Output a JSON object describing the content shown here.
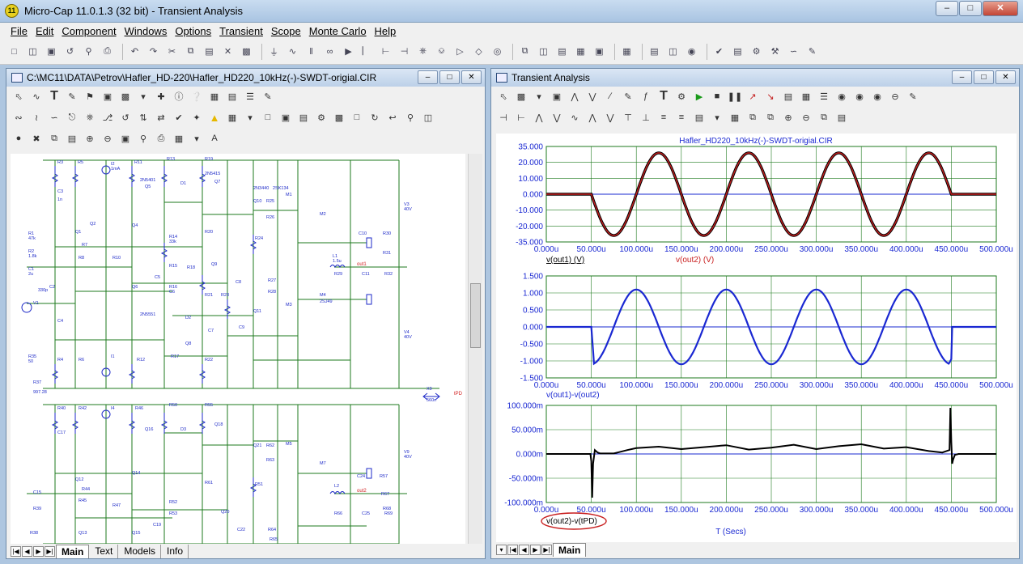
{
  "window": {
    "title": "Micro-Cap 11.0.1.3 (32 bit) - Transient Analysis",
    "icon_text": "11"
  },
  "menu": [
    "File",
    "Edit",
    "Component",
    "Windows",
    "Options",
    "Transient",
    "Scope",
    "Monte Carlo",
    "Help"
  ],
  "schematic_window": {
    "title": "C:\\MC11\\DATA\\Petrov\\Hafler_HD-220\\Hafler_HD220_10kHz(-)-SWDT-origial.CIR",
    "tabs": [
      "Main",
      "Text",
      "Models",
      "Info"
    ],
    "active_tab": "Main",
    "labels": {
      "r3": "R3",
      "r5": "R5",
      "i2": "I2",
      "i2v": "1mA",
      "r11": "R11",
      "r13": "R13",
      "r19": "R19",
      "n2n5415": "2N5415",
      "q7": "Q7",
      "q5": "Q5",
      "n2n5401": "2N5401",
      "d1": "D1",
      "c3": "C3",
      "c3v": "1n",
      "q2": "Q2",
      "r1": "R1",
      "r1v": "47k",
      "r2": "R2",
      "r2v": "1.8k",
      "c1": "C1",
      "c1v": "2u",
      "v1": "V1",
      "c2": "C2",
      "c2v": "330p",
      "q1": "Q1",
      "r7": "R7",
      "r8": "R8",
      "r10": "R10",
      "q6": "Q6",
      "q4": "Q4",
      "r14": "R14",
      "r14v": "33k",
      "r15": "R15",
      "r18": "R18",
      "c5": "C5",
      "c6": "C6",
      "r16": "R16",
      "q9": "Q9",
      "r20": "R20",
      "r21": "R21",
      "r23": "R23",
      "c8": "C8",
      "q10": "Q10",
      "n2n3440": "2N3440",
      "n2sk134": "2SK134",
      "m1": "M1",
      "r25": "R25",
      "r26": "R26",
      "m2": "M2",
      "r24": "R24",
      "v3": "V3",
      "v3v": "40V",
      "c10": "C10",
      "r30": "R30",
      "l1": "L1",
      "l1v": "1.5u",
      "out1": "out1",
      "r31": "R31",
      "r29": "R29",
      "c11": "C11",
      "r32": "R32",
      "r27": "R27",
      "r28": "R28",
      "m3": "M3",
      "m4": "M4",
      "n2sj49": "2SJ49",
      "q11": "Q11",
      "c9": "C9",
      "c7": "C7",
      "d2": "D2",
      "q8": "Q8",
      "n2n5551": "2N5551",
      "c4": "C4",
      "r4": "R4",
      "r6": "R6",
      "i1": "I1",
      "r12": "R12",
      "r17": "R17",
      "r22": "R22",
      "v4": "V4",
      "v4v": "40V",
      "r35": "R35",
      "r35v": "50",
      "r37": "R37",
      "r37v": "997.28",
      "x9": "X9",
      "x9v": "560n",
      "tpd": "tPD",
      "r40": "R40",
      "r42": "R42",
      "i4": "I4",
      "r46": "R46",
      "r50": "R50",
      "r55": "R55",
      "q16": "Q16",
      "q18": "Q18",
      "d3": "D3",
      "c17": "C17",
      "q21": "Q21",
      "m5": "M5",
      "r62": "R62",
      "r63": "R63",
      "v9": "V9",
      "v9v": "40V",
      "m7": "M7",
      "r51": "R51",
      "q12": "Q12",
      "q14": "Q14",
      "r44": "R44",
      "r57": "R57",
      "r61": "R61",
      "c24": "C24",
      "r67": "R67",
      "r68": "R68",
      "c15": "C15",
      "r39": "R39",
      "r45": "R45",
      "r47": "R47",
      "r52": "R52",
      "r53": "R53",
      "q20": "Q20",
      "c19": "C19",
      "l2": "L2",
      "out2": "out2",
      "r66": "R66",
      "c25": "C25",
      "r69": "R69",
      "r38": "R38",
      "q13": "Q13",
      "q15": "Q15",
      "r64": "R64",
      "c22": "C22",
      "r65": "R65"
    }
  },
  "transient_window": {
    "title": "Transient Analysis",
    "plot_title": "Hafler_HD220_10kHz(-)-SWDT-origial.CIR",
    "tabs": [
      "Main"
    ],
    "active_tab": "Main"
  },
  "chart_data": [
    {
      "type": "line",
      "title": "Hafler_HD220_10kHz(-)-SWDT-origial.CIR",
      "xlabel": "",
      "ylabel": "",
      "x_ticks": [
        "0.000u",
        "50.000u",
        "100.000u",
        "150.000u",
        "200.000u",
        "250.000u",
        "300.000u",
        "350.000u",
        "400.000u",
        "450.000u",
        "500.000u"
      ],
      "y_ticks": [
        "35.000",
        "20.000",
        "10.000",
        "0.000",
        "-10.000",
        "-20.000",
        "-35.000"
      ],
      "xlim": [
        0,
        500
      ],
      "ylim": [
        -35,
        35
      ],
      "grid": true,
      "series": [
        {
          "name": "v(out1) (V)",
          "color": "#000000",
          "x": [
            0,
            50,
            75,
            100,
            125,
            150,
            175,
            200,
            225,
            250,
            275,
            300,
            325,
            350,
            375,
            400,
            425,
            450,
            500
          ],
          "y": [
            0,
            0,
            -17.5,
            -30.3,
            -17.5,
            17.5,
            30.3,
            17.5,
            -17.5,
            -30.3,
            -17.5,
            17.5,
            30.3,
            17.5,
            -17.5,
            -30.3,
            -17.5,
            0,
            0
          ]
        },
        {
          "name": "v(out2) (V)",
          "color": "#c81e1e",
          "x": [
            0,
            50,
            75,
            100,
            125,
            150,
            175,
            200,
            225,
            250,
            275,
            300,
            325,
            350,
            375,
            400,
            425,
            450,
            500
          ],
          "y": [
            0,
            0,
            -17.5,
            -30.3,
            -17.5,
            17.5,
            30.3,
            17.5,
            -17.5,
            -30.3,
            -17.5,
            17.5,
            30.3,
            17.5,
            -17.5,
            -30.3,
            -17.5,
            0,
            0
          ]
        }
      ]
    },
    {
      "type": "line",
      "title": "",
      "xlabel": "",
      "ylabel": "",
      "x_ticks": [
        "0.000u",
        "50.000u",
        "100.000u",
        "150.000u",
        "200.000u",
        "250.000u",
        "300.000u",
        "350.000u",
        "400.000u",
        "450.000u",
        "500.000u"
      ],
      "y_ticks": [
        "1.500",
        "1.000",
        "0.500",
        "0.000",
        "-0.500",
        "-1.000",
        "-1.500"
      ],
      "xlim": [
        0,
        500
      ],
      "ylim": [
        -1.5,
        1.5
      ],
      "grid": true,
      "series": [
        {
          "name": "v(out1)-v(out2)",
          "color": "#1a28d2",
          "x": [
            0,
            49,
            50,
            52,
            55,
            60,
            75,
            100,
            125,
            150,
            175,
            200,
            225,
            250,
            275,
            300,
            325,
            350,
            375,
            400,
            425,
            440,
            447,
            450,
            451,
            500
          ],
          "y": [
            0,
            0,
            -0.3,
            -1.05,
            -1.1,
            -1.02,
            -0.55,
            1.1,
            0.55,
            -1.1,
            -0.55,
            1.1,
            0.55,
            -1.1,
            -0.55,
            1.1,
            0.55,
            -1.1,
            -0.55,
            1.1,
            0.55,
            -0.8,
            -1.1,
            -0.95,
            0,
            0
          ]
        }
      ]
    },
    {
      "type": "line",
      "title": "",
      "xlabel": "T (Secs)",
      "ylabel": "",
      "x_ticks": [
        "0.000u",
        "50.000u",
        "100.000u",
        "150.000u",
        "200.000u",
        "250.000u",
        "300.000u",
        "350.000u",
        "400.000u",
        "450.000u",
        "500.000u"
      ],
      "y_ticks": [
        "100.000m",
        "50.000m",
        "0.000m",
        "-50.000m",
        "-100.000m"
      ],
      "xlim": [
        0,
        500
      ],
      "ylim": [
        -100,
        100
      ],
      "grid": true,
      "series": [
        {
          "name": "v(out2)-v(tPD)",
          "color": "#000000",
          "x": [
            0,
            49,
            50,
            51,
            52,
            54,
            57,
            60,
            75,
            90,
            100,
            125,
            150,
            175,
            200,
            225,
            250,
            275,
            300,
            325,
            350,
            375,
            400,
            425,
            440,
            448,
            449,
            450,
            451,
            452,
            454,
            458,
            470,
            500
          ],
          "y": [
            0,
            0,
            -15,
            -90,
            -20,
            8,
            3,
            1,
            1,
            8,
            12,
            15,
            10,
            14,
            18,
            9,
            13,
            19,
            10,
            16,
            20,
            11,
            14,
            6,
            3,
            8,
            95,
            25,
            -20,
            -12,
            -2,
            0,
            0,
            0
          ]
        }
      ]
    }
  ]
}
